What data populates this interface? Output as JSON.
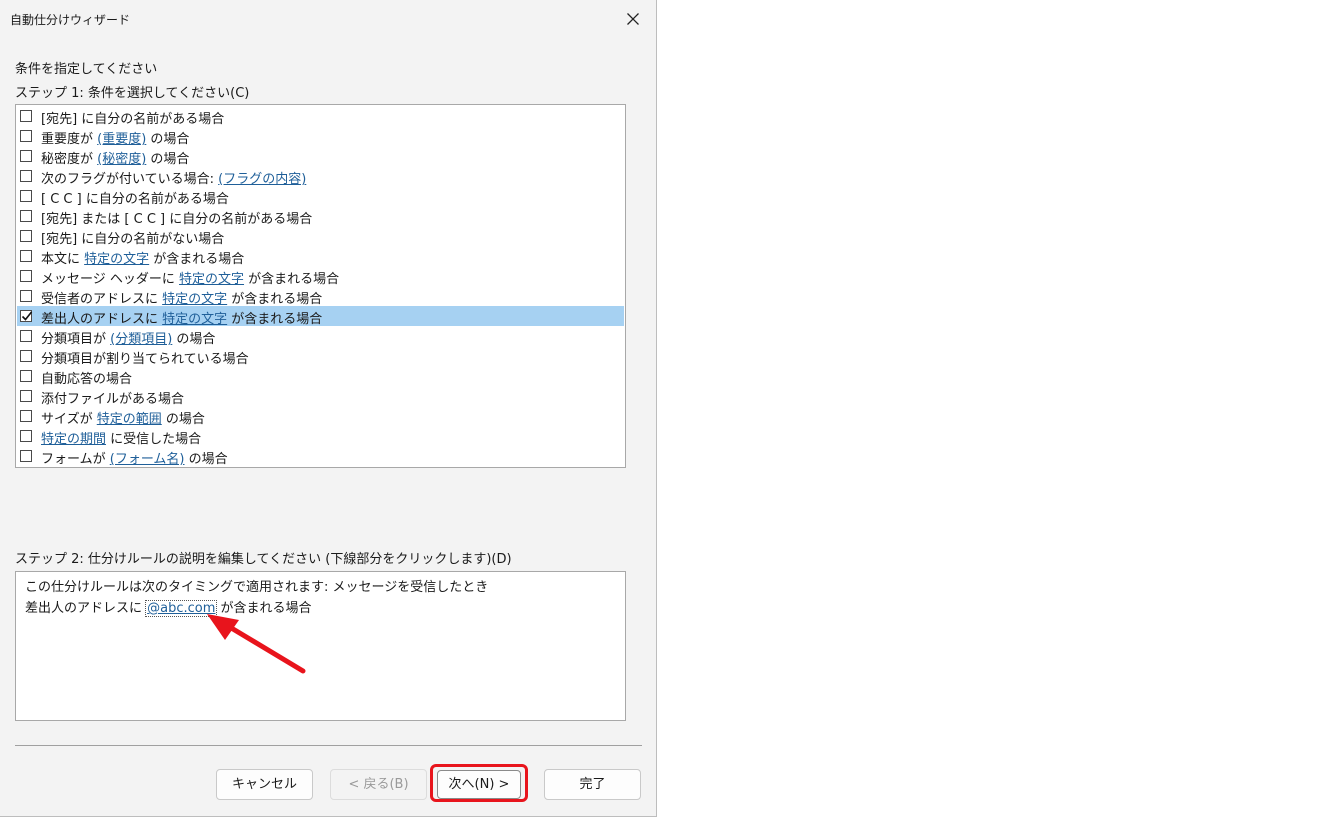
{
  "dialog": {
    "title": "自動仕分けウィザード",
    "instruction": "条件を指定してください",
    "step1_label": "ステップ 1: 条件を選択してください(C)",
    "step2_label": "ステップ 2: 仕分けルールの説明を編集してください (下線部分をクリックします)(D)"
  },
  "conditions": [
    {
      "pre": "[宛先] に自分の名前がある場合",
      "link": "",
      "post": "",
      "checked": false
    },
    {
      "pre": "重要度が ",
      "link": "(重要度)",
      "post": " の場合",
      "checked": false
    },
    {
      "pre": "秘密度が ",
      "link": "(秘密度)",
      "post": " の場合",
      "checked": false
    },
    {
      "pre": "次のフラグが付いている場合: ",
      "link": "(フラグの内容)",
      "post": "",
      "checked": false
    },
    {
      "pre": "[ C C ] に自分の名前がある場合",
      "link": "",
      "post": "",
      "checked": false
    },
    {
      "pre": "[宛先] または [ C C ] に自分の名前がある場合",
      "link": "",
      "post": "",
      "checked": false
    },
    {
      "pre": "[宛先] に自分の名前がない場合",
      "link": "",
      "post": "",
      "checked": false
    },
    {
      "pre": "本文に ",
      "link": "特定の文字",
      "post": " が含まれる場合",
      "checked": false
    },
    {
      "pre": "メッセージ ヘッダーに ",
      "link": "特定の文字",
      "post": " が含まれる場合",
      "checked": false
    },
    {
      "pre": "受信者のアドレスに ",
      "link": "特定の文字",
      "post": " が含まれる場合",
      "checked": false
    },
    {
      "pre": "差出人のアドレスに ",
      "link": "特定の文字",
      "post": " が含まれる場合",
      "checked": true
    },
    {
      "pre": "分類項目が ",
      "link": "(分類項目)",
      "post": " の場合",
      "checked": false
    },
    {
      "pre": "分類項目が割り当てられている場合",
      "link": "",
      "post": "",
      "checked": false
    },
    {
      "pre": "自動応答の場合",
      "link": "",
      "post": "",
      "checked": false
    },
    {
      "pre": "添付ファイルがある場合",
      "link": "",
      "post": "",
      "checked": false
    },
    {
      "pre": "サイズが ",
      "link": "特定の範囲",
      "post": " の場合",
      "checked": false
    },
    {
      "pre": "",
      "link": "特定の期間",
      "post": " に受信した場合",
      "checked": false
    },
    {
      "pre": "フォームが ",
      "link": "(フォーム名)",
      "post": " の場合",
      "checked": false
    }
  ],
  "description": {
    "line1": "この仕分けルールは次のタイミングで適用されます: メッセージを受信したとき",
    "line2_pre": "差出人のアドレスに ",
    "line2_link": "@abc.com",
    "line2_post": " が含まれる場合"
  },
  "buttons": {
    "cancel": "キャンセル",
    "back": "< 戻る(B)",
    "next": "次へ(N) >",
    "finish": "完了"
  },
  "colors": {
    "selection": "#a6d1f2",
    "link": "#1f5f99",
    "annotation": "#e8141c"
  },
  "icons": {
    "close": "close-icon",
    "check": "checkmark-icon",
    "annotation_arrow": "red-arrow-icon"
  }
}
